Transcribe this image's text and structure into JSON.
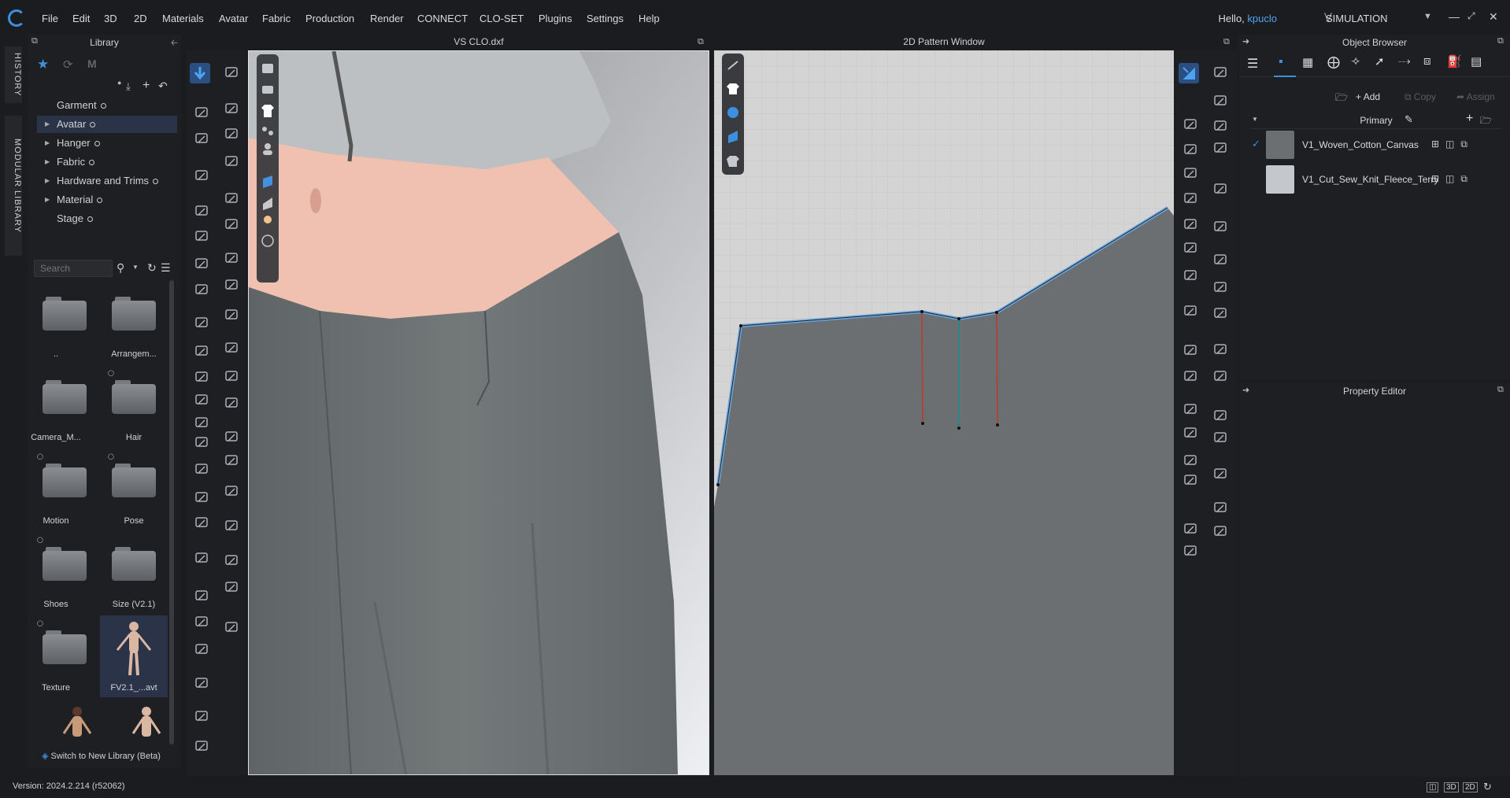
{
  "menu": {
    "items": [
      "File",
      "Edit",
      "3D",
      "2D",
      "Materials",
      "Avatar",
      "Fabric",
      "Production",
      "Render",
      "CONNECT",
      "CLO-SET",
      "Plugins",
      "Settings",
      "Help"
    ],
    "greeting": "Hello,",
    "username": "kpuclo",
    "mode": "SIMULATION"
  },
  "vtabs": {
    "history": "HISTORY",
    "modular": "MODULAR LIBRARY"
  },
  "library": {
    "title": "Library",
    "tree": [
      {
        "label": "Garment"
      },
      {
        "label": "Avatar",
        "selected": true
      },
      {
        "label": "Hanger"
      },
      {
        "label": "Fabric"
      },
      {
        "label": "Hardware and Trims"
      },
      {
        "label": "Material"
      },
      {
        "label": "Stage"
      }
    ],
    "search_placeholder": "Search",
    "thumbnails": [
      "..",
      "Arrangem...",
      "Camera_M...",
      "Hair",
      "Motion",
      "Pose",
      "Shoes",
      "Size (V2.1)",
      "Texture",
      "FV2.1_...avt"
    ],
    "switch_label": "Switch to New Library (Beta)"
  },
  "viewport3d": {
    "title": "VS CLO.dxf"
  },
  "viewport2d": {
    "title": "2D Pattern Window"
  },
  "object_browser": {
    "title": "Object Browser",
    "add_label": "Add",
    "copy_label": "Copy",
    "assign_label": "Assign",
    "group_label": "Primary",
    "fabrics": [
      {
        "name": "V1_Woven_Cotton_Canvas",
        "color": "#6b6f72",
        "checked": true
      },
      {
        "name": "V1_Cut_Sew_Knit_Fleece_Terry",
        "color": "#c4c7cb",
        "checked": false
      }
    ]
  },
  "property_editor": {
    "title": "Property Editor"
  },
  "status": {
    "version": "Version: 2024.2.214 (r52062)",
    "view_3d": "3D",
    "view_2d": "2D"
  },
  "colors": {
    "accent": "#3d8fe0",
    "selection_line": "#6aa6e0",
    "dart_red": "#c0392b",
    "dart_teal": "#1f8a8a"
  }
}
